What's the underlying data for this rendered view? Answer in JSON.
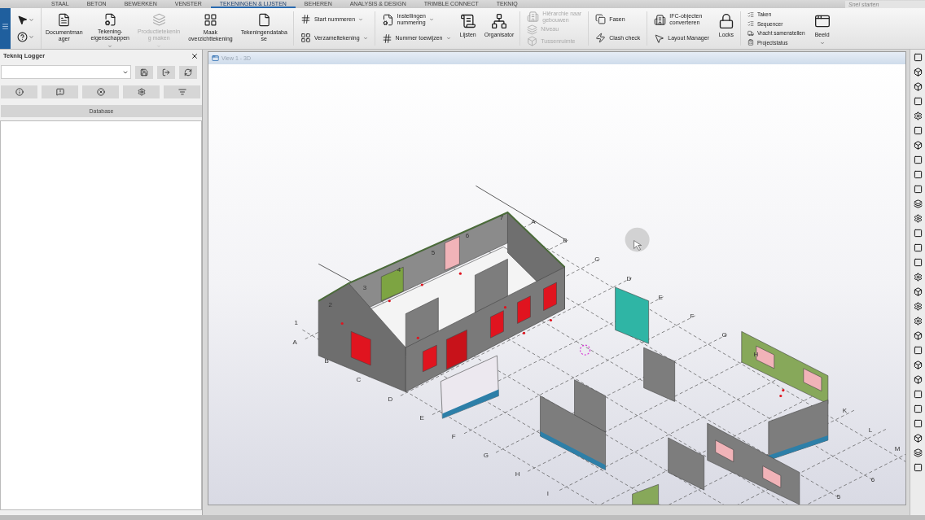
{
  "tabs": [
    {
      "label": "STAAL",
      "selected": false
    },
    {
      "label": "BETON",
      "selected": false
    },
    {
      "label": "BEWERKEN",
      "selected": false
    },
    {
      "label": "VENSTER",
      "selected": false
    },
    {
      "label": "TEKENINGEN & LIJSTEN",
      "selected": true
    },
    {
      "label": "BEHEREN",
      "selected": false
    },
    {
      "label": "ANALYSIS & DESIGN",
      "selected": false
    },
    {
      "label": "TRIMBLE CONNECT",
      "selected": false
    },
    {
      "label": "TEKNIQ",
      "selected": false
    }
  ],
  "search": {
    "placeholder": "Snel starten"
  },
  "ribbon": [
    {
      "kind": "tools"
    },
    {
      "kind": "large",
      "lines": [
        "Documentman",
        "ager"
      ],
      "disabled": false,
      "dropdown": false
    },
    {
      "kind": "large",
      "lines": [
        "Tekening-",
        "eigenschappen"
      ],
      "disabled": false,
      "dropdown": true
    },
    {
      "kind": "large",
      "lines": [
        "Productietekenin",
        "g maken"
      ],
      "disabled": true,
      "dropdown": true
    },
    {
      "kind": "large",
      "lines": [
        "Maak",
        "overzichttekening"
      ],
      "disabled": false,
      "dropdown": false
    },
    {
      "kind": "large",
      "lines": [
        "Tekeningendataba",
        "se"
      ],
      "disabled": false,
      "dropdown": false
    },
    {
      "kind": "stack",
      "items": [
        {
          "lines": [
            "Start nummeren"
          ],
          "disabled": false,
          "dropdown": true
        },
        {
          "lines": [
            "Verzameltekening"
          ],
          "disabled": false,
          "dropdown": true
        }
      ]
    },
    {
      "kind": "stack",
      "items": [
        {
          "lines": [
            "Instellingen",
            "nummering"
          ],
          "disabled": false,
          "dropdown": true
        },
        {
          "lines": [
            "Nummer toewijzen"
          ],
          "disabled": false,
          "dropdown": true
        }
      ]
    },
    {
      "kind": "large",
      "lines": [
        "Lijsten"
      ],
      "disabled": false,
      "dropdown": false
    },
    {
      "kind": "large",
      "lines": [
        "Organisator"
      ],
      "disabled": false,
      "dropdown": false
    },
    {
      "kind": "stack",
      "items": [
        {
          "lines": [
            "Hiërarchie naar",
            "gebouwen"
          ],
          "disabled": true,
          "dropdown": false
        },
        {
          "lines": [
            "Niveau"
          ],
          "disabled": true,
          "dropdown": false
        },
        {
          "lines": [
            "Tussenruimte"
          ],
          "disabled": true,
          "dropdown": false
        }
      ]
    },
    {
      "kind": "stack",
      "items": [
        {
          "lines": [
            "Fasen"
          ],
          "disabled": false,
          "dropdown": false
        },
        {
          "lines": [
            "Clash check"
          ],
          "disabled": false,
          "dropdown": false
        }
      ]
    },
    {
      "kind": "stack",
      "items": [
        {
          "lines": [
            "IFC-objecten",
            "converteren"
          ],
          "disabled": false,
          "dropdown": false
        },
        {
          "lines": [
            "Layout Manager"
          ],
          "disabled": false,
          "dropdown": false
        }
      ]
    },
    {
      "kind": "large",
      "lines": [
        "Locks"
      ],
      "disabled": false,
      "dropdown": false
    },
    {
      "kind": "small",
      "items": [
        {
          "lines": [
            "Taken"
          ],
          "disabled": false,
          "dropdown": false
        },
        {
          "lines": [
            "Sequencer"
          ],
          "disabled": false,
          "dropdown": false
        },
        {
          "lines": [
            "Vracht samenstellen"
          ],
          "disabled": false,
          "dropdown": false
        },
        {
          "lines": [
            "Projectstatus"
          ],
          "disabled": false,
          "dropdown": false
        }
      ]
    },
    {
      "kind": "large",
      "lines": [
        "Beeld"
      ],
      "disabled": false,
      "dropdown": true
    }
  ],
  "logger": {
    "title": "Tekniq Logger",
    "database_button": "Database"
  },
  "view": {
    "title": "View 1 - 3D",
    "grid": {
      "front_letters": [
        "A",
        "B",
        "C",
        "D",
        "E",
        "F",
        "G",
        "H",
        "I"
      ],
      "back_letters": [
        "A",
        "B",
        "C",
        "D",
        "E",
        "F",
        "G",
        "H"
      ],
      "far_letters": [
        "K",
        "L",
        "M"
      ],
      "left_numbers": [
        "1",
        "2",
        "3",
        "4",
        "5",
        "6",
        "7"
      ],
      "far_numbers": [
        "5",
        "6"
      ]
    }
  }
}
